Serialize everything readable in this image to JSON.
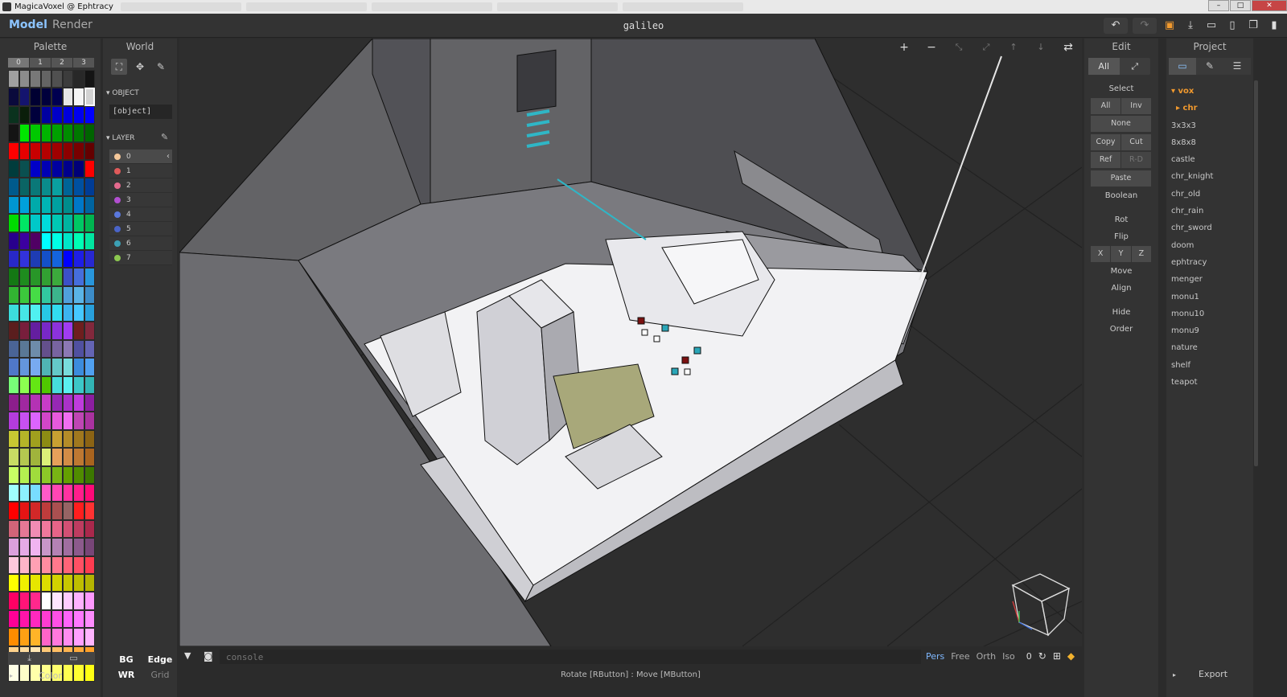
{
  "window": {
    "title": "MagicaVoxel @ Ephtracy",
    "controls": [
      "–",
      "□",
      "✕"
    ]
  },
  "topbar": {
    "modes": {
      "model": "Model",
      "render": "Render"
    },
    "document_title": "galileo"
  },
  "palette": {
    "title": "Palette",
    "tabs": [
      "0",
      "1",
      "2",
      "3"
    ],
    "footer_label": "Color",
    "colors": [
      "#a0a0a0",
      "#8c8c8c",
      "#787878",
      "#646464",
      "#505050",
      "#3c3c3c",
      "#282828",
      "#141414",
      "#0a0a3c",
      "#14146e",
      "#000032",
      "#00003c",
      "#000050",
      "#e6e6e6",
      "#f5f5f5",
      "#d2d2d2",
      "#0a321e",
      "#0a1e0a",
      "#00003c",
      "#0000a0",
      "#0000c8",
      "#0000dc",
      "#0000f0",
      "#0000ff",
      "#141414",
      "#00e600",
      "#00c800",
      "#00b400",
      "#00a000",
      "#008c00",
      "#007800",
      "#006400",
      "#ff0000",
      "#e60000",
      "#c80000",
      "#b40000",
      "#a00000",
      "#8c0000",
      "#780000",
      "#640000",
      "#003c3c",
      "#0a5050",
      "#0000c8",
      "#0000b4",
      "#0000a0",
      "#00008c",
      "#000078",
      "#ff0000",
      "#005a8c",
      "#0a6464",
      "#0a7878",
      "#0a8c8c",
      "#0aa0a0",
      "#006496",
      "#0050a0",
      "#003c96",
      "#0096d2",
      "#00a0dc",
      "#00aaaa",
      "#00b4b4",
      "#00a0a0",
      "#008c8c",
      "#0078c8",
      "#0064a0",
      "#00dc00",
      "#00e664",
      "#00c8c8",
      "#00dcdc",
      "#00c8b4",
      "#00b4a0",
      "#00c864",
      "#00b450",
      "#28008c",
      "#3c00a0",
      "#500064",
      "#00ffff",
      "#00ffe6",
      "#00e6c8",
      "#00ffb4",
      "#00e6a0",
      "#2828c8",
      "#3232dc",
      "#1e3cb4",
      "#1450c8",
      "#1464dc",
      "#0000ff",
      "#1e1ee6",
      "#2828d2",
      "#147814",
      "#1e8c1e",
      "#289628",
      "#32a032",
      "#3caa3c",
      "#3c50c8",
      "#466edc",
      "#2896dc",
      "#32b432",
      "#3cc83c",
      "#46dc46",
      "#32c8a0",
      "#3cb48c",
      "#50a0dc",
      "#5ab4e6",
      "#3c8cc8",
      "#3cdcdc",
      "#46e6e6",
      "#50f0f0",
      "#28c8e6",
      "#32dcf0",
      "#3cb4f0",
      "#46c8ff",
      "#28a0dc",
      "#5a1e1e",
      "#781e3c",
      "#641ea0",
      "#7828c8",
      "#8c32dc",
      "#a03cf0",
      "#6e1e1e",
      "#82283c",
      "#4a6496",
      "#5a7896",
      "#6e8caa",
      "#64508c",
      "#7864a0",
      "#8c78b4",
      "#5050a0",
      "#6464b4",
      "#5078c8",
      "#6496dc",
      "#78aaf0",
      "#50b4b4",
      "#64c8c8",
      "#78dcdc",
      "#3c8cdc",
      "#50a0f0",
      "#78ff78",
      "#8cff50",
      "#64e614",
      "#50c800",
      "#46dcdc",
      "#5af0f0",
      "#3cc8c8",
      "#32b4b4",
      "#8c1e8c",
      "#a028a0",
      "#b432b4",
      "#c83cc8",
      "#9628b4",
      "#aa32c8",
      "#be3cdc",
      "#8c1ea0",
      "#b43cdc",
      "#c850f0",
      "#dc64ff",
      "#d246c8",
      "#e65adc",
      "#f06ef0",
      "#be46b4",
      "#aa32a0",
      "#c8c832",
      "#b4b428",
      "#a0a01e",
      "#8c8c14",
      "#c8a032",
      "#b48c28",
      "#a0781e",
      "#8c6414",
      "#c8dc64",
      "#b4c850",
      "#a0b43c",
      "#dcf078",
      "#e6a05a",
      "#d28c46",
      "#be7832",
      "#aa641e",
      "#c8ff64",
      "#b4f050",
      "#a0dc3c",
      "#8cc828",
      "#78b414",
      "#64a000",
      "#508c00",
      "#3c7800",
      "#a0ffff",
      "#8cf0ff",
      "#78dcff",
      "#ff5ac8",
      "#ff46b4",
      "#ff32a0",
      "#ff1e8c",
      "#ff0a78",
      "#ff0000",
      "#e61414",
      "#d22828",
      "#be3c3c",
      "#aa5050",
      "#966464",
      "#ff1e1e",
      "#ff3232",
      "#d26478",
      "#e67896",
      "#f08cb4",
      "#f0789c",
      "#e66488",
      "#d25074",
      "#be3c60",
      "#aa284c",
      "#dca0dc",
      "#e6aae6",
      "#f0b4f0",
      "#c896c8",
      "#b482b4",
      "#a06ea0",
      "#8c5a8c",
      "#784678",
      "#ffc8dc",
      "#ffb4c8",
      "#ffa0b4",
      "#ff8ca0",
      "#ff788c",
      "#ff6478",
      "#ff5064",
      "#ff3c50",
      "#ffff00",
      "#f0f000",
      "#e6e600",
      "#dcdc00",
      "#d2d200",
      "#c8c800",
      "#bebe00",
      "#b4b400",
      "#ff0064",
      "#ff1478",
      "#ff288c",
      "#ffffff",
      "#ffe6ff",
      "#ffccff",
      "#ffb2ff",
      "#ff99ff",
      "#ff0096",
      "#ff14aa",
      "#ff28be",
      "#ff3cd2",
      "#ff50e6",
      "#ff64fa",
      "#ff78ff",
      "#ff8cff",
      "#ff8c00",
      "#ffa014",
      "#ffb428",
      "#ff64c8",
      "#ff78dc",
      "#ff8cf0",
      "#ffa0ff",
      "#ffb4ff",
      "#ffd28c",
      "#ffdca0",
      "#ffe6b4",
      "#ffc878",
      "#ffbe64",
      "#ffb450",
      "#ffaa3c",
      "#ffa028",
      "#ffffe6",
      "#ffffc8",
      "#ffffaa",
      "#ffff8c",
      "#ffff6e",
      "#ffff50",
      "#ffff32",
      "#ffff14"
    ],
    "selected_index": 15
  },
  "world": {
    "title": "World",
    "object_section": "OBJECT",
    "object_value": "[object]",
    "layer_section": "LAYER",
    "layers": [
      {
        "label": "0",
        "color": "#f5c89a"
      },
      {
        "label": "1",
        "color": "#e05a5a"
      },
      {
        "label": "2",
        "color": "#e46a8e"
      },
      {
        "label": "3",
        "color": "#b24fd0"
      },
      {
        "label": "4",
        "color": "#5a78dc"
      },
      {
        "label": "5",
        "color": "#4a64c8"
      },
      {
        "label": "6",
        "color": "#3ca0b4"
      },
      {
        "label": "7",
        "color": "#8cc850"
      }
    ],
    "toggles": {
      "bg": "BG",
      "edge": "Edge",
      "wr": "WR",
      "grid": "Grid"
    }
  },
  "viewport": {
    "console_placeholder": "console",
    "view_modes": [
      "Pers",
      "Free",
      "Orth",
      "Iso"
    ],
    "active_view_mode": "Pers",
    "counter": "0",
    "status": "Rotate [RButton] : Move [MButton]"
  },
  "edit": {
    "title": "Edit",
    "tabs": [
      "All",
      "⤢"
    ],
    "select_label": "Select",
    "buttons": {
      "all": "All",
      "inv": "Inv",
      "none": "None",
      "copy": "Copy",
      "cut": "Cut",
      "ref": "Ref",
      "rd": "R-D",
      "paste": "Paste",
      "boolean": "Boolean",
      "rot": "Rot",
      "flip": "Flip",
      "x": "X",
      "y": "Y",
      "z": "Z",
      "move": "Move",
      "align": "Align",
      "hide": "Hide",
      "order": "Order"
    }
  },
  "project": {
    "title": "Project",
    "folder": "vox",
    "subfolder": "chr",
    "files": [
      "3x3x3",
      "8x8x8",
      "castle",
      "chr_knight",
      "chr_old",
      "chr_rain",
      "chr_sword",
      "doom",
      "ephtracy",
      "menger",
      "monu1",
      "monu10",
      "monu9",
      "nature",
      "shelf",
      "teapot"
    ],
    "export_label": "Export"
  },
  "colors": {
    "accent_blue": "#8cc4ff",
    "accent_orange": "#f29a2e",
    "viewport_bg": "#2e2e2e"
  }
}
